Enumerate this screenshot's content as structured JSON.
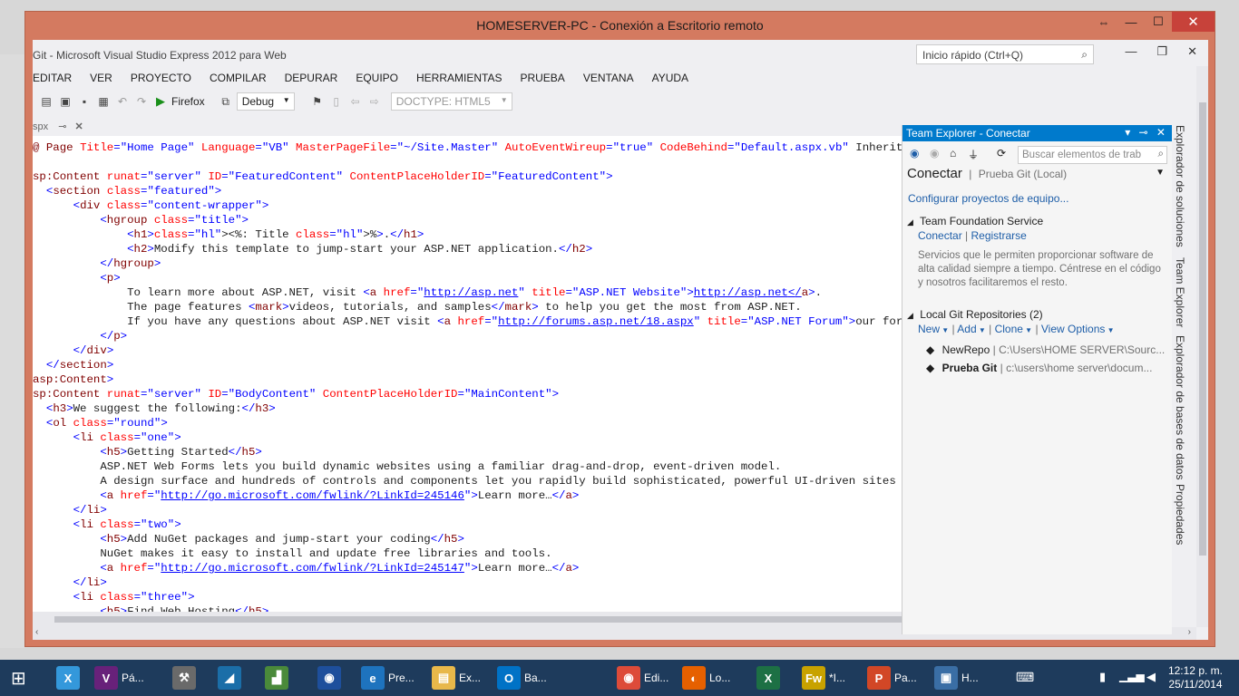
{
  "rdp": {
    "title": "HOMESERVER-PC - Conexión a Escritorio remoto"
  },
  "vs": {
    "title": "Git - Microsoft Visual Studio Express 2012 para Web",
    "quick_launch": "Inicio rápido (Ctrl+Q)",
    "menu": [
      "EDITAR",
      "VER",
      "PROYECTO",
      "COMPILAR",
      "DEPURAR",
      "EQUIPO",
      "HERRAMIENTAS",
      "PRUEBA",
      "VENTANA",
      "AYUDA"
    ],
    "toolbar": {
      "browser": "Firefox",
      "config": "Debug",
      "doctype": "DOCTYPE: HTML5"
    },
    "doc_tab": "spx"
  },
  "code_lines": [
    "@ Page Title=\"Home Page\" Language=\"VB\" MasterPageFile=\"~/Site.Master\" AutoEventWireup=\"true\" CodeBehind=\"Default.aspx.vb\" Inherits=\"Prueb",
    "",
    "sp:Content runat=\"server\" ID=\"FeaturedContent\" ContentPlaceHolderID=\"FeaturedContent\">",
    "  <section class=\"featured\">",
    "      <div class=\"content-wrapper\">",
    "          <hgroup class=\"title\">",
    "              <h1><%: Title %>.</h1>",
    "              <h2>Modify this template to jump-start your ASP.NET application.</h2>",
    "          </hgroup>",
    "          <p>",
    "              To learn more about ASP.NET, visit <a href=\"http://asp.net\" title=\"ASP.NET Website\">http://asp.net</a>.",
    "              The page features <mark>videos, tutorials, and samples</mark> to help you get the most from ASP.NET.",
    "              If you have any questions about ASP.NET visit <a href=\"http://forums.asp.net/18.aspx\" title=\"ASP.NET Forum\">our forums</a>.",
    "          </p>",
    "      </div>",
    "  </section>",
    "asp:Content>",
    "sp:Content runat=\"server\" ID=\"BodyContent\" ContentPlaceHolderID=\"MainContent\">",
    "  <h3>We suggest the following:</h3>",
    "  <ol class=\"round\">",
    "      <li class=\"one\">",
    "          <h5>Getting Started</h5>",
    "          ASP.NET Web Forms lets you build dynamic websites using a familiar drag-and-drop, event-driven model.",
    "          A design surface and hundreds of controls and components let you rapidly build sophisticated, powerful UI-driven sites with dat",
    "          <a href=\"http://go.microsoft.com/fwlink/?LinkId=245146\">Learn more…</a>",
    "      </li>",
    "      <li class=\"two\">",
    "          <h5>Add NuGet packages and jump-start your coding</h5>",
    "          NuGet makes it easy to install and update free libraries and tools.",
    "          <a href=\"http://go.microsoft.com/fwlink/?LinkId=245147\">Learn more…</a>",
    "      </li>",
    "      <li class=\"three\">",
    "          <h5>Find Web Hosting</h5>"
  ],
  "team_explorer": {
    "header": "Team Explorer - Conectar",
    "search_placeholder": "Buscar elementos de trab",
    "title": "Conectar",
    "subtitle": "Prueba Git (Local)",
    "configure_link": "Configurar proyectos de equipo...",
    "tfs": {
      "title": "Team Foundation Service",
      "connect": "Conectar",
      "register": "Registrarse",
      "description": "Servicios que le permiten proporcionar software de alta calidad siempre a tiempo. Céntrese en el código y nosotros facilitaremos el resto."
    },
    "git": {
      "title": "Local Git Repositories (2)",
      "actions": [
        "New",
        "Add",
        "Clone",
        "View Options"
      ],
      "repos": [
        {
          "name": "NewRepo",
          "path": "C:\\Users\\HOME SERVER\\Sourc..."
        },
        {
          "name": "Prueba Git",
          "path": "c:\\users\\home server\\docum..."
        }
      ]
    }
  },
  "side_tabs": [
    "Explorador de soluciones",
    "Team Explorer",
    "Explorador de bases de datos",
    "Propiedades"
  ],
  "taskbar": {
    "items": [
      {
        "label": "Pá...",
        "color": "#68217a",
        "glyph": "V"
      },
      {
        "label": "Pre...",
        "color": "#1e73be",
        "glyph": "e"
      },
      {
        "label": "Ex...",
        "color": "#e8b84a",
        "glyph": "▤"
      },
      {
        "label": "Ba...",
        "color": "#0072c6",
        "glyph": "O"
      },
      {
        "label": "Edi...",
        "color": "#dd4b39",
        "glyph": "◉"
      },
      {
        "label": "Lo...",
        "color": "#e66000",
        "glyph": "◐"
      },
      {
        "label": "*I...",
        "color": "#c8a200",
        "glyph": "Fw"
      },
      {
        "label": "Pa...",
        "color": "#d24726",
        "glyph": "P"
      },
      {
        "label": "H...",
        "color": "#3a6ea5",
        "glyph": "▣"
      }
    ],
    "time": "12:12 p. m.",
    "date": "25/11/2014"
  }
}
